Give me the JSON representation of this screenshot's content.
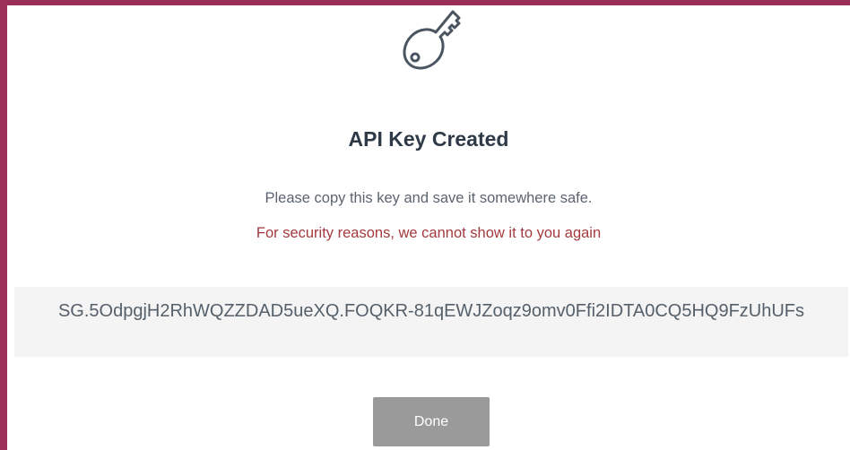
{
  "dialog": {
    "icon": "key-icon",
    "title": "API Key Created",
    "subtitle": "Please copy this key and save it somewhere safe.",
    "warning": "For security reasons, we cannot show it to you again",
    "api_key": "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",
    "done_label": "Done"
  },
  "colors": {
    "backdrop": "#9b2f55",
    "title": "#2f3a48",
    "warning": "#a33a3e",
    "key_box": "#f4f4f4",
    "done_button": "#9a9a9a"
  }
}
